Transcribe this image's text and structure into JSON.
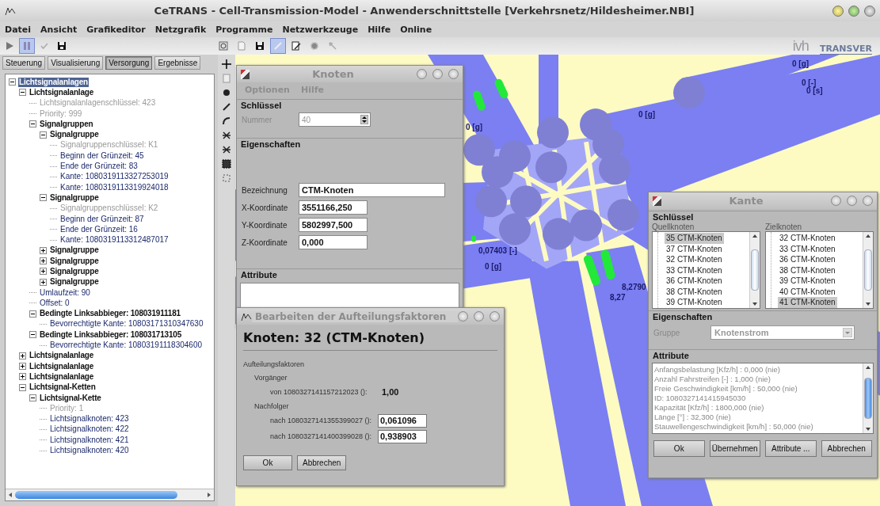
{
  "window": {
    "title": "CeTRANS - Cell-Transmission-Model - Anwenderschnittstelle [Verkehrsnetz/Hildesheimer.NBI]"
  },
  "menu": [
    "Datei",
    "Ansicht",
    "Grafikeditor",
    "Netzgrafik",
    "Programme",
    "Netzwerkzeuge",
    "Hilfe",
    "Online"
  ],
  "toolbar": [
    {
      "kind": "play",
      "active": false
    },
    {
      "kind": "pause",
      "active": true
    },
    {
      "kind": "check",
      "active": false
    },
    {
      "kind": "save",
      "active": false
    }
  ],
  "map_toolbar": [
    {
      "kind": "refresh",
      "active": false
    },
    {
      "kind": "document",
      "active": false
    },
    {
      "kind": "save",
      "active": false
    },
    {
      "kind": "pen",
      "active": true
    },
    {
      "kind": "edit",
      "active": false
    },
    {
      "kind": "gear",
      "active": false
    },
    {
      "kind": "pointer",
      "active": false
    }
  ],
  "logos": [
    "ivh",
    "TRANSVER"
  ],
  "tabs": [
    {
      "label": "Steuerung",
      "selected": false
    },
    {
      "label": "Visualisierung",
      "selected": false
    },
    {
      "label": "Versorgung",
      "selected": true
    },
    {
      "label": "Ergebnisse",
      "selected": false
    }
  ],
  "side_tools": [
    {
      "kind": "plus"
    },
    {
      "kind": "page"
    },
    {
      "kind": "node"
    },
    {
      "kind": "link"
    },
    {
      "kind": "curve"
    },
    {
      "kind": "cross"
    },
    {
      "kind": "cross"
    },
    {
      "kind": "grid"
    },
    {
      "kind": "shape"
    }
  ],
  "tree": [
    {
      "label": "Lichtsignalanlagen",
      "kind": "group",
      "expanded": true,
      "selected": true,
      "children": [
        {
          "label": "Lichtsignalanlage",
          "kind": "group",
          "expanded": true,
          "selected": false,
          "children": [
            {
              "label": "Lichtsignalanlagenschlüssel: 423",
              "kind": "leaf",
              "disabled": true,
              "selected": false
            },
            {
              "label": "Priority: 999",
              "kind": "leaf",
              "disabled": true,
              "selected": false
            },
            {
              "label": "Signalgruppen",
              "kind": "group",
              "expanded": true,
              "selected": false,
              "children": [
                {
                  "label": "Signalgruppe",
                  "kind": "group",
                  "expanded": true,
                  "selected": false,
                  "children": [
                    {
                      "label": "Signalgruppenschlüssel: K1",
                      "kind": "leaf",
                      "disabled": true,
                      "selected": false
                    },
                    {
                      "label": "Beginn der Grünzeit: 45",
                      "kind": "leaf",
                      "disabled": false,
                      "selected": false
                    },
                    {
                      "label": "Ende der Grünzeit: 83",
                      "kind": "leaf",
                      "disabled": false,
                      "selected": false
                    },
                    {
                      "label": "Kante: 1080319113327253019",
                      "kind": "leaf",
                      "disabled": false,
                      "selected": false
                    },
                    {
                      "label": "Kante: 1080319113319924018",
                      "kind": "leaf",
                      "disabled": false,
                      "selected": false
                    }
                  ]
                },
                {
                  "label": "Signalgruppe",
                  "kind": "group",
                  "expanded": true,
                  "selected": false,
                  "children": [
                    {
                      "label": "Signalgruppenschlüssel: K2",
                      "kind": "leaf",
                      "disabled": true,
                      "selected": false
                    },
                    {
                      "label": "Beginn der Grünzeit: 87",
                      "kind": "leaf",
                      "disabled": false,
                      "selected": false
                    },
                    {
                      "label": "Ende der Grünzeit: 16",
                      "kind": "leaf",
                      "disabled": false,
                      "selected": false
                    },
                    {
                      "label": "Kante: 1080319113312487017",
                      "kind": "leaf",
                      "disabled": false,
                      "selected": false
                    }
                  ]
                },
                {
                  "label": "Signalgruppe",
                  "kind": "group",
                  "expanded": false,
                  "selected": false
                },
                {
                  "label": "Signalgruppe",
                  "kind": "group",
                  "expanded": false,
                  "selected": false
                },
                {
                  "label": "Signalgruppe",
                  "kind": "group",
                  "expanded": false,
                  "selected": false
                },
                {
                  "label": "Signalgruppe",
                  "kind": "group",
                  "expanded": false,
                  "selected": false
                }
              ]
            },
            {
              "label": "Umlaufzeit: 90",
              "kind": "leaf",
              "disabled": false,
              "selected": false
            },
            {
              "label": "Offset: 0",
              "kind": "leaf",
              "disabled": false,
              "selected": false
            },
            {
              "label": "Bedingte Linksabbieger: 108031911181",
              "kind": "group",
              "expanded": true,
              "selected": false,
              "children": [
                {
                  "label": "Bevorrechtigte Kante: 10803171310347630",
                  "kind": "leaf",
                  "disabled": false,
                  "selected": false
                }
              ]
            },
            {
              "label": "Bedingte Linksabbieger: 108031713105",
              "kind": "group",
              "expanded": true,
              "selected": false,
              "children": [
                {
                  "label": "Bevorrechtigte Kante: 10803191118304600",
                  "kind": "leaf",
                  "disabled": false,
                  "selected": false
                }
              ]
            }
          ]
        },
        {
          "label": "Lichtsignalanlage",
          "kind": "group",
          "expanded": false,
          "selected": false
        },
        {
          "label": "Lichtsignalanlage",
          "kind": "group",
          "expanded": false,
          "selected": false
        },
        {
          "label": "Lichtsignalanlage",
          "kind": "group",
          "expanded": false,
          "selected": false
        },
        {
          "label": "Lichtsignal-Ketten",
          "kind": "group",
          "expanded": true,
          "selected": false,
          "children": [
            {
              "label": "Lichtsignal-Kette",
              "kind": "group",
              "expanded": true,
              "selected": false,
              "children": [
                {
                  "label": "Priority: 1",
                  "kind": "leaf",
                  "disabled": true,
                  "selected": false
                },
                {
                  "label": "Lichtsignalknoten: 423",
                  "kind": "leaf",
                  "disabled": false,
                  "selected": false
                },
                {
                  "label": "Lichtsignalknoten: 422",
                  "kind": "leaf",
                  "disabled": false,
                  "selected": false
                },
                {
                  "label": "Lichtsignalknoten: 421",
                  "kind": "leaf",
                  "disabled": false,
                  "selected": false
                },
                {
                  "label": "Lichtsignalknoten: 420",
                  "kind": "leaf",
                  "disabled": false,
                  "selected": false
                }
              ]
            }
          ]
        }
      ]
    }
  ],
  "map_labels": [
    "0 [g]",
    "0 [-]",
    "0 [s]",
    "0 [g]",
    "0 [g]",
    "0,07403 [-]",
    "0 [g]",
    "8,2790",
    "8,27"
  ],
  "knoten": {
    "title": "Knoten",
    "menu": [
      {
        "label": "Optionen",
        "disabled": true
      },
      {
        "label": "Hilfe",
        "disabled": true
      }
    ],
    "key_group": "Schlüssel",
    "number": {
      "label": "Nummer",
      "value": "40",
      "disabled": true
    },
    "props_group": "Eigenschaften",
    "fields": [
      {
        "label": "Bezeichnung",
        "value": "CTM-Knoten",
        "kind": "wide"
      },
      {
        "label": "X-Koordinate",
        "value": "3551166,250",
        "kind": "narrow"
      },
      {
        "label": "Y-Koordinate",
        "value": "5802997,500",
        "kind": "narrow"
      },
      {
        "label": "Z-Koordinate",
        "value": "0,000",
        "kind": "narrow"
      }
    ],
    "attr_group": "Attribute"
  },
  "aufteilung": {
    "title": "Bearbeiten der Aufteilungsfaktoren",
    "heading": "Knoten: 32 (CTM-Knoten)",
    "section": "Aufteilungsfaktoren",
    "predecessor_label": "Vorgänger",
    "predecessors": [
      {
        "label": "von 1080327141157212023 ():",
        "value": "1,00"
      }
    ],
    "successor_label": "Nachfolger",
    "successors": [
      {
        "label": "nach 1080327141355399027 ():",
        "value": "0,061096"
      },
      {
        "label": "nach 1080327141400399028 ():",
        "value": "0,938903"
      }
    ],
    "buttons": [
      "Ok",
      "Abbrechen"
    ]
  },
  "kante": {
    "title": "Kante",
    "key_group": "Schlüssel",
    "source_label": "Quellknoten",
    "target_label": "Zielknoten",
    "sources": [
      {
        "label": "35 CTM-Knoten",
        "selected": true
      },
      {
        "label": "37 CTM-Knoten",
        "selected": false
      },
      {
        "label": "32 CTM-Knoten",
        "selected": false
      },
      {
        "label": "33 CTM-Knoten",
        "selected": false
      },
      {
        "label": "36 CTM-Knoten",
        "selected": false
      },
      {
        "label": "38 CTM-Knoten",
        "selected": false
      },
      {
        "label": "39 CTM-Knoten",
        "selected": false
      }
    ],
    "targets": [
      {
        "label": "32 CTM-Knoten",
        "selected": false
      },
      {
        "label": "33 CTM-Knoten",
        "selected": false
      },
      {
        "label": "36 CTM-Knoten",
        "selected": false
      },
      {
        "label": "38 CTM-Knoten",
        "selected": false
      },
      {
        "label": "39 CTM-Knoten",
        "selected": false
      },
      {
        "label": "40 CTM-Knoten",
        "selected": false
      },
      {
        "label": "41 CTM-Knoten",
        "selected": true
      }
    ],
    "props_group": "Eigenschaften",
    "group": {
      "label": "Gruppe",
      "value": "Knotenstrom",
      "disabled": true
    },
    "attr_group": "Attribute",
    "attributes": [
      "Anfangsbelastung [Kfz/h] : 0,000 (nie)",
      "Anzahl Fahrstreifen [-] : 1,000 (nie)",
      "Freie Geschwindigkeit [km/h] : 50,000 (nie)",
      "ID: 1080327141415945030",
      "Kapazität [Kfz/h] : 1800,000 (nie)",
      "Länge [°] : 32,300 (nie)",
      "Stauwellengeschwindigkeit [km/h] : 50,000 (nie)"
    ],
    "buttons": [
      "Ok",
      "Übernehmen",
      "Attribute ...",
      "Abbrechen"
    ]
  }
}
